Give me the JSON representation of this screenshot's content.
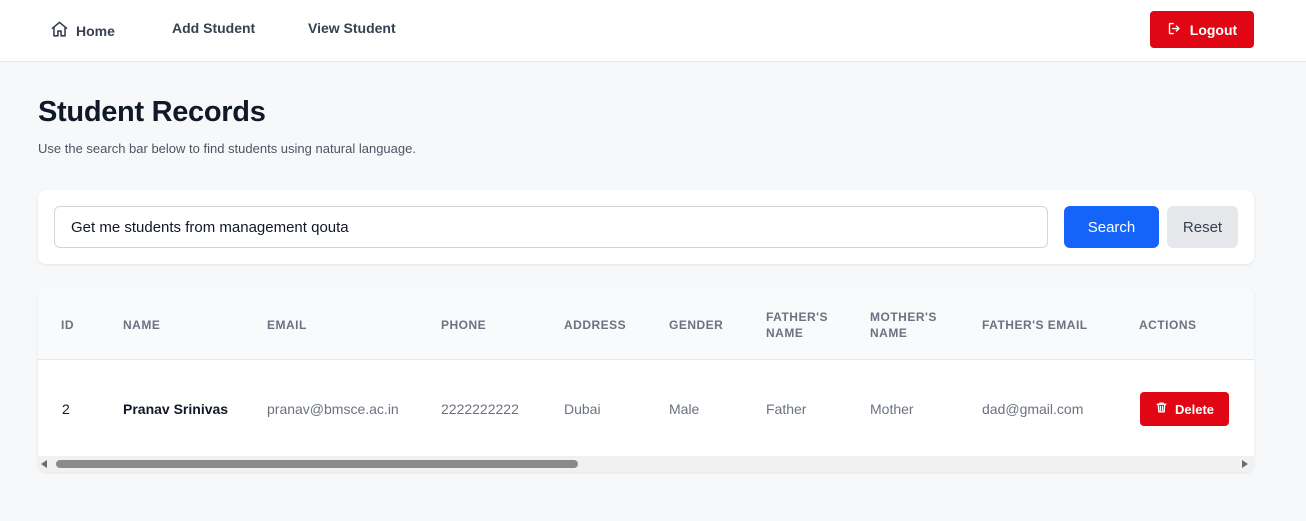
{
  "nav": {
    "home_label": "Home",
    "add_student_label": "Add Student",
    "view_student_label": "View Student",
    "logout_label": "Logout"
  },
  "page": {
    "title": "Student Records",
    "subtitle": "Use the search bar below to find students using natural language."
  },
  "search": {
    "value": "Get me students from management qouta",
    "search_label": "Search",
    "reset_label": "Reset"
  },
  "table": {
    "headers": {
      "id": "ID",
      "name": "NAME",
      "email": "EMAIL",
      "phone": "PHONE",
      "address": "ADDRESS",
      "gender": "GENDER",
      "fathers_name_line1": "FATHER'S",
      "fathers_name_line2": "NAME",
      "mothers_name_line1": "MOTHER'S",
      "mothers_name_line2": "NAME",
      "fathers_email": "FATHER'S EMAIL",
      "actions": "ACTIONS"
    },
    "rows": [
      {
        "id": "2",
        "name": "Pranav Srinivas",
        "email": "pranav@bmsce.ac.in",
        "phone": "2222222222",
        "address": "Dubai",
        "gender": "Male",
        "fathers_name": "Father",
        "mothers_name": "Mother",
        "fathers_email": "dad@gmail.com",
        "delete_label": "Delete"
      }
    ]
  },
  "colors": {
    "primary": "#1464fa",
    "danger": "#e00613",
    "background": "#f7f8fa"
  },
  "icons": {
    "home": "home-icon",
    "logout": "logout-icon",
    "delete": "trash-icon"
  }
}
